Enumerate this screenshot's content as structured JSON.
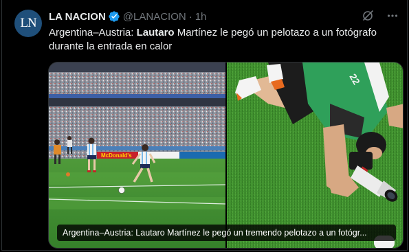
{
  "tweet": {
    "author_name": "LA NACION",
    "avatar_initials": "LN",
    "handle": "@LANACION",
    "separator": "·",
    "time": "1h",
    "text_part1": "Argentina–Austria: ",
    "text_bold": "Lautaro",
    "text_part2": " Martínez le pegó un pelotazo a un fotógrafo durante la entrada en calor"
  },
  "media": {
    "caption": "Argentina–Austria: Lautaro Martínez le pegó un tremendo pelotazo a un fotógr...",
    "left_ad_text": "McDonald's"
  },
  "colors": {
    "background": "#000000",
    "text": "#e7e9ea",
    "muted": "#71767b",
    "verified": "#1d9bf0",
    "avatar": "#1f4f7a",
    "pitch": "#3d8a2c",
    "jersey": "#2fa05a"
  },
  "icons": [
    "verified-badge-icon",
    "grok-icon",
    "more-icon"
  ]
}
